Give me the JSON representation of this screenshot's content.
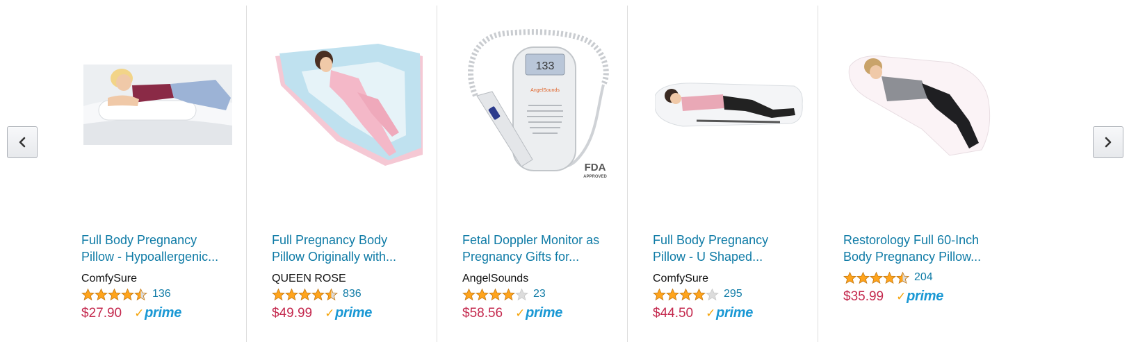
{
  "carousel": {
    "prev_label": "Previous",
    "next_label": "Next",
    "products": [
      {
        "title_line1": "Full Body Pregnancy",
        "title_line2": "Pillow - Hypoallergenic...",
        "brand": "ComfySure",
        "rating": 4.5,
        "reviews": "136",
        "price": "$27.90",
        "prime": "prime"
      },
      {
        "title_line1": "Full Pregnancy Body",
        "title_line2": "Pillow Originally with...",
        "brand": "QUEEN ROSE",
        "rating": 4.5,
        "reviews": "836",
        "price": "$49.99",
        "prime": "prime"
      },
      {
        "title_line1": "Fetal Doppler Monitor as",
        "title_line2": "Pregnancy Gifts for...",
        "brand": "AngelSounds",
        "rating": 4.0,
        "reviews": "23",
        "price": "$58.56",
        "prime": "prime",
        "device_display": "133",
        "device_brand": "AngelSounds",
        "badge_top": "FDA",
        "badge_bottom": "APPROVED"
      },
      {
        "title_line1": "Full Body Pregnancy",
        "title_line2": "Pillow - U Shaped...",
        "brand": "ComfySure",
        "rating": 4.0,
        "reviews": "295",
        "price": "$44.50",
        "prime": "prime"
      },
      {
        "title_line1": "Restorology Full 60-Inch",
        "title_line2": "Body Pregnancy Pillow...",
        "brand": "",
        "rating": 4.5,
        "reviews": "204",
        "price": "$35.99",
        "prime": "prime"
      }
    ]
  },
  "colors": {
    "link": "#0f7ba6",
    "price": "#c4284d",
    "star": "#ffa41c",
    "prime": "#1a98d4"
  }
}
